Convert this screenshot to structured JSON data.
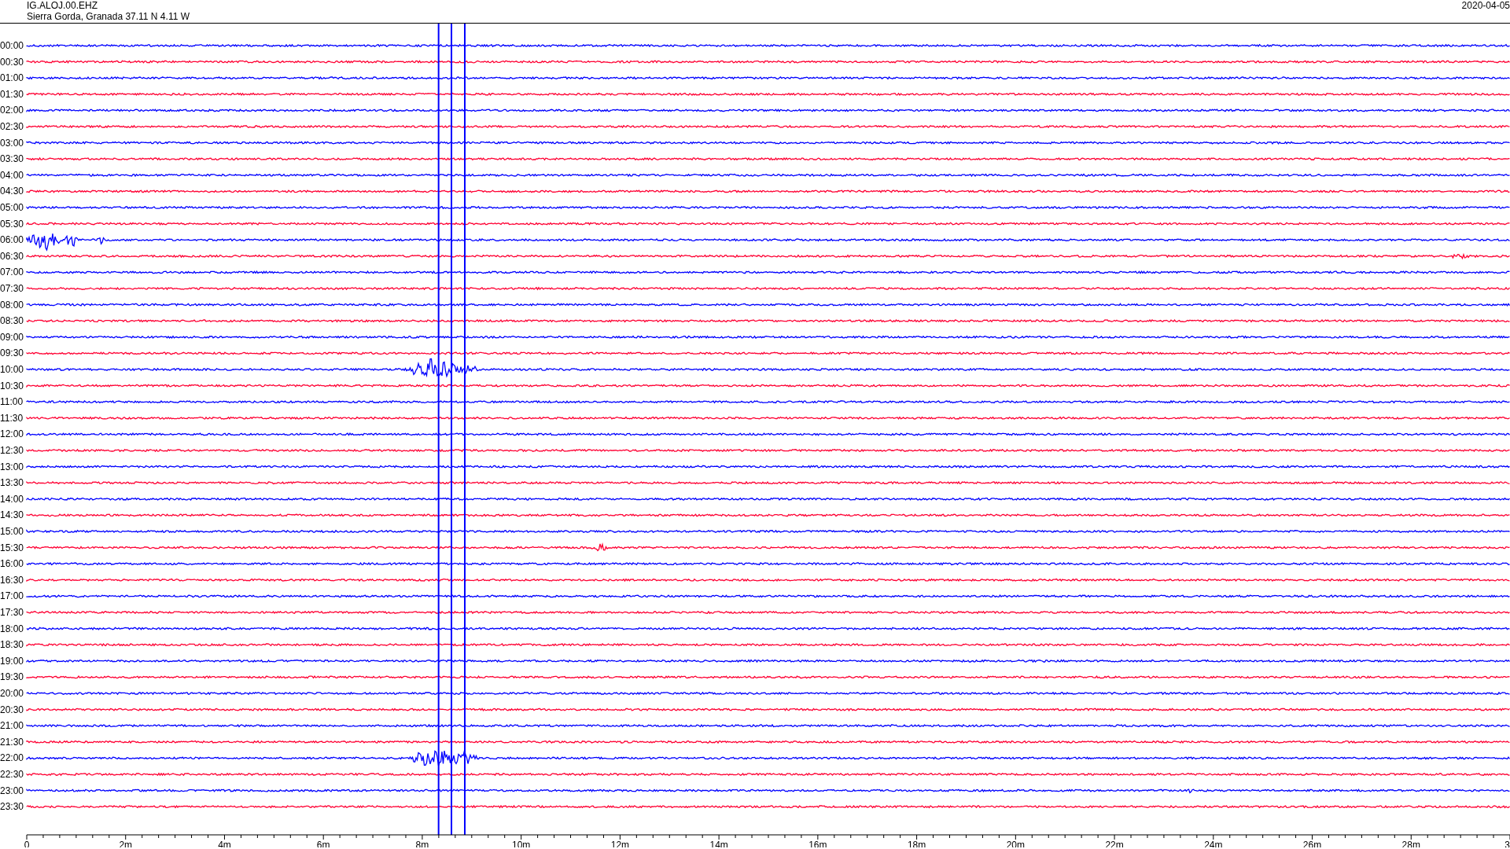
{
  "header": {
    "station": "IG.ALOJ.00.EHZ",
    "location": "Sierra Gorda, Granada  37.11 N 4.11 W",
    "date": "2020-04-05"
  },
  "rows": [
    {
      "label": "00:00",
      "color": "#0000ff"
    },
    {
      "label": "00:30",
      "color": "#ff0033"
    },
    {
      "label": "01:00",
      "color": "#0000ff"
    },
    {
      "label": "01:30",
      "color": "#ff0033"
    },
    {
      "label": "02:00",
      "color": "#0000ff"
    },
    {
      "label": "02:30",
      "color": "#ff0033"
    },
    {
      "label": "03:00",
      "color": "#0000ff"
    },
    {
      "label": "03:30",
      "color": "#ff0033"
    },
    {
      "label": "04:00",
      "color": "#0000ff"
    },
    {
      "label": "04:30",
      "color": "#ff0033"
    },
    {
      "label": "05:00",
      "color": "#0000ff"
    },
    {
      "label": "05:30",
      "color": "#ff0033"
    },
    {
      "label": "06:00",
      "color": "#0000ff"
    },
    {
      "label": "06:30",
      "color": "#ff0033"
    },
    {
      "label": "07:00",
      "color": "#0000ff"
    },
    {
      "label": "07:30",
      "color": "#ff0033"
    },
    {
      "label": "08:00",
      "color": "#0000ff"
    },
    {
      "label": "08:30",
      "color": "#ff0033"
    },
    {
      "label": "09:00",
      "color": "#0000ff"
    },
    {
      "label": "09:30",
      "color": "#ff0033"
    },
    {
      "label": "10:00",
      "color": "#0000ff"
    },
    {
      "label": "10:30",
      "color": "#ff0033"
    },
    {
      "label": "11:00",
      "color": "#0000ff"
    },
    {
      "label": "11:30",
      "color": "#ff0033"
    },
    {
      "label": "12:00",
      "color": "#0000ff"
    },
    {
      "label": "12:30",
      "color": "#ff0033"
    },
    {
      "label": "13:00",
      "color": "#0000ff"
    },
    {
      "label": "13:30",
      "color": "#ff0033"
    },
    {
      "label": "14:00",
      "color": "#0000ff"
    },
    {
      "label": "14:30",
      "color": "#ff0033"
    },
    {
      "label": "15:00",
      "color": "#0000ff"
    },
    {
      "label": "15:30",
      "color": "#ff0033"
    },
    {
      "label": "16:00",
      "color": "#0000ff"
    },
    {
      "label": "16:30",
      "color": "#ff0033"
    },
    {
      "label": "17:00",
      "color": "#0000ff"
    },
    {
      "label": "17:30",
      "color": "#ff0033"
    },
    {
      "label": "18:00",
      "color": "#0000ff"
    },
    {
      "label": "18:30",
      "color": "#ff0033"
    },
    {
      "label": "19:00",
      "color": "#0000ff"
    },
    {
      "label": "19:30",
      "color": "#ff0033"
    },
    {
      "label": "20:00",
      "color": "#0000ff"
    },
    {
      "label": "20:30",
      "color": "#ff0033"
    },
    {
      "label": "21:00",
      "color": "#0000ff"
    },
    {
      "label": "21:30",
      "color": "#ff0033"
    },
    {
      "label": "22:00",
      "color": "#0000ff"
    },
    {
      "label": "22:30",
      "color": "#ff0033"
    },
    {
      "label": "23:00",
      "color": "#0000ff"
    },
    {
      "label": "23:30",
      "color": "#ff0033"
    }
  ],
  "x_axis": {
    "ticks": [
      "0",
      "2m",
      "4m",
      "6m",
      "8m",
      "10m",
      "12m",
      "14m",
      "16m",
      "18m",
      "20m",
      "22m",
      "24m",
      "26m",
      "28m",
      "3"
    ]
  }
}
